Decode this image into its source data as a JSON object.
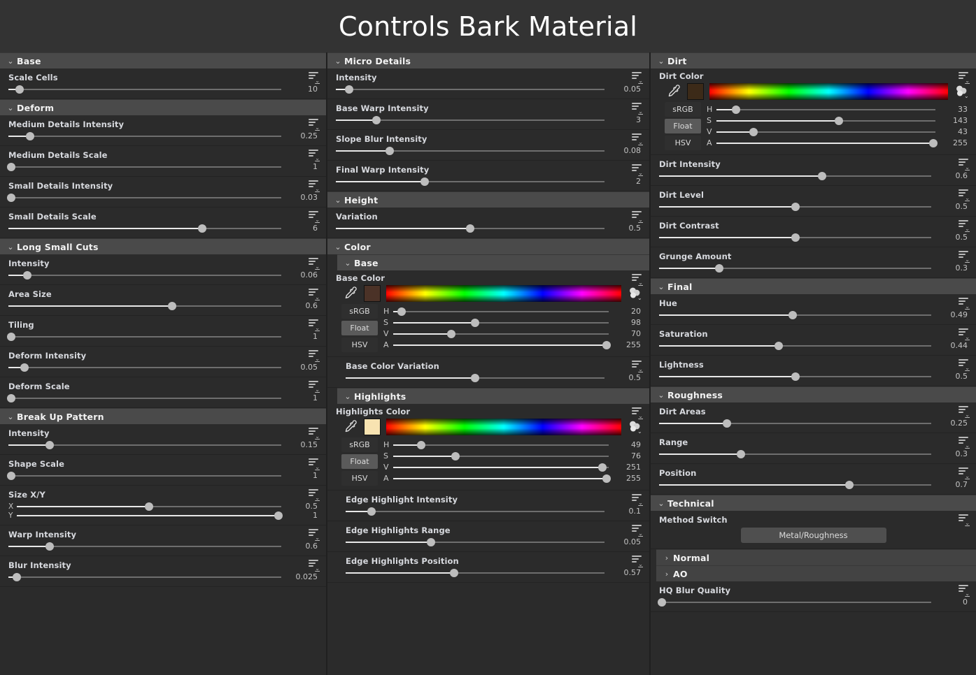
{
  "header": {
    "title": "Controls Bark Material"
  },
  "icons": {
    "menu": "list-menu-icon",
    "eyedropper": "eyedropper-icon",
    "palette": "color-palette-icon",
    "chevron_down": "⌄",
    "chevron_right": "›"
  },
  "columns": [
    {
      "id": "column-left",
      "sections": [
        {
          "name": "Base",
          "collapsed": false,
          "params": [
            {
              "label": "Scale Cells",
              "value": "10",
              "pos": 4
            }
          ]
        },
        {
          "name": "Deform",
          "collapsed": false,
          "params": [
            {
              "label": "Medium Details Intensity",
              "value": "0.25",
              "pos": 8
            },
            {
              "label": "Medium Details Scale",
              "value": "1",
              "pos": 1
            },
            {
              "label": "Small Details Intensity",
              "value": "0.03",
              "pos": 1
            },
            {
              "label": "Small Details Scale",
              "value": "6",
              "pos": 71
            }
          ]
        },
        {
          "name": "Long Small Cuts",
          "collapsed": false,
          "params": [
            {
              "label": "Intensity",
              "value": "0.06",
              "pos": 7
            },
            {
              "label": "Area Size",
              "value": "0.6",
              "pos": 60
            },
            {
              "label": "Tiling",
              "value": "1",
              "pos": 1
            },
            {
              "label": "Deform Intensity",
              "value": "0.05",
              "pos": 6
            },
            {
              "label": "Deform Scale",
              "value": "1",
              "pos": 1
            }
          ]
        },
        {
          "name": "Break Up Pattern",
          "collapsed": false,
          "params": [
            {
              "label": "Intensity",
              "value": "0.15",
              "pos": 15
            },
            {
              "label": "Shape Scale",
              "value": "1",
              "pos": 1
            },
            {
              "label": "Size X/Y",
              "axes": [
                {
                  "axis": "X",
                  "value": "0.5",
                  "pos": 50
                },
                {
                  "axis": "Y",
                  "value": "1",
                  "pos": 99
                }
              ]
            },
            {
              "label": "Warp Intensity",
              "value": "0.6",
              "pos": 15
            },
            {
              "label": "Blur Intensity",
              "value": "0.025",
              "pos": 3
            }
          ]
        }
      ]
    },
    {
      "id": "column-middle",
      "sections": [
        {
          "name": "Micro Details",
          "collapsed": false,
          "params": [
            {
              "label": "Intensity",
              "value": "0.05",
              "pos": 5
            },
            {
              "label": "Base Warp Intensity",
              "value": "3",
              "pos": 15
            },
            {
              "label": "Slope Blur Intensity",
              "value": "0.08",
              "pos": 20
            },
            {
              "label": "Final Warp Intensity",
              "value": "2",
              "pos": 33
            }
          ]
        },
        {
          "name": "Height",
          "collapsed": false,
          "params": [
            {
              "label": "Variation",
              "value": "0.5",
              "pos": 50
            }
          ]
        },
        {
          "name": "Color",
          "collapsed": false,
          "params": [],
          "subsections": [
            {
              "name": "Base",
              "collapsed": false,
              "color": {
                "label": "Base Color",
                "swatch": "#4b3227",
                "modes": [
                  "sRGB",
                  "Float",
                  "HSV"
                ],
                "active_mode": "Float",
                "channels": [
                  {
                    "name": "H",
                    "value": "20",
                    "pos": 4
                  },
                  {
                    "name": "S",
                    "value": "98",
                    "pos": 38
                  },
                  {
                    "name": "V",
                    "value": "70",
                    "pos": 27
                  },
                  {
                    "name": "A",
                    "value": "255",
                    "pos": 99
                  }
                ]
              },
              "params": [
                {
                  "label": "Base Color Variation",
                  "value": "0.5",
                  "pos": 50
                }
              ]
            },
            {
              "name": "Highlights",
              "collapsed": false,
              "color": {
                "label": "Highlights Color",
                "swatch": "#f8e3b1",
                "modes": [
                  "sRGB",
                  "Float",
                  "HSV"
                ],
                "active_mode": "Float",
                "channels": [
                  {
                    "name": "H",
                    "value": "49",
                    "pos": 13
                  },
                  {
                    "name": "S",
                    "value": "76",
                    "pos": 29
                  },
                  {
                    "name": "V",
                    "value": "251",
                    "pos": 97
                  },
                  {
                    "name": "A",
                    "value": "255",
                    "pos": 99
                  }
                ]
              },
              "params": [
                {
                  "label": "Edge Highlight Intensity",
                  "value": "0.1",
                  "pos": 10
                },
                {
                  "label": "Edge Highlights Range",
                  "value": "0.05",
                  "pos": 33
                },
                {
                  "label": "Edge Highlights Position",
                  "value": "0.57",
                  "pos": 42
                }
              ]
            }
          ]
        }
      ]
    },
    {
      "id": "column-right",
      "sections": [
        {
          "name": "Dirt",
          "collapsed": false,
          "color": {
            "label": "Dirt Color",
            "swatch": "#3c2a18",
            "modes": [
              "sRGB",
              "Float",
              "HSV"
            ],
            "active_mode": "Float",
            "channels": [
              {
                "name": "H",
                "value": "33",
                "pos": 9
              },
              {
                "name": "S",
                "value": "143",
                "pos": 56
              },
              {
                "name": "V",
                "value": "43",
                "pos": 17
              },
              {
                "name": "A",
                "value": "255",
                "pos": 99
              }
            ]
          },
          "params": [
            {
              "label": "Dirt Intensity",
              "value": "0.6",
              "pos": 60
            },
            {
              "label": "Dirt Level",
              "value": "0.5",
              "pos": 50
            },
            {
              "label": "Dirt Contrast",
              "value": "0.5",
              "pos": 50
            },
            {
              "label": "Grunge Amount",
              "value": "0.3",
              "pos": 22
            }
          ]
        },
        {
          "name": "Final",
          "collapsed": false,
          "params": [
            {
              "label": "Hue",
              "value": "0.49",
              "pos": 49
            },
            {
              "label": "Saturation",
              "value": "0.44",
              "pos": 44
            },
            {
              "label": "Lightness",
              "value": "0.5",
              "pos": 50
            }
          ]
        },
        {
          "name": "Roughness",
          "collapsed": false,
          "params": [
            {
              "label": "Dirt Areas",
              "value": "0.25",
              "pos": 25
            },
            {
              "label": "Range",
              "value": "0.3",
              "pos": 30
            },
            {
              "label": "Position",
              "value": "0.7",
              "pos": 70
            }
          ]
        },
        {
          "name": "Technical",
          "collapsed": false,
          "method_switch": {
            "label": "Method Switch",
            "value": "Metal/Roughness"
          },
          "subsections": [
            {
              "name": "Normal",
              "collapsed": true
            },
            {
              "name": "AO",
              "collapsed": true
            }
          ],
          "params_after": [
            {
              "label": "HQ Blur Quality",
              "value": "0",
              "pos": 1
            }
          ]
        }
      ]
    }
  ]
}
